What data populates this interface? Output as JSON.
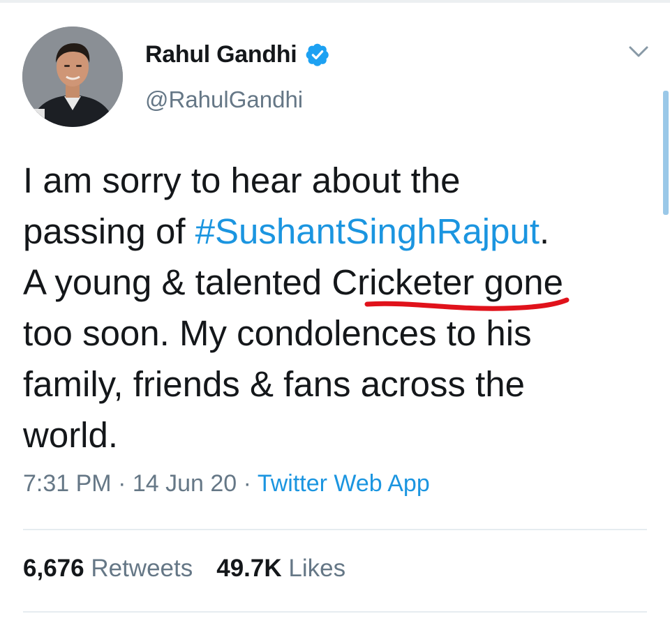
{
  "tweet": {
    "author": {
      "display_name": "Rahul Gandhi",
      "handle": "@RahulGandhi",
      "verified": true
    },
    "text_lines": [
      [
        "I am sorry to hear about the"
      ],
      [
        "passing of ",
        "#SushantSinghRajput",
        "."
      ],
      [
        "A young & talented ",
        "Cricketer gone"
      ],
      [
        "too soon. My condolences to his"
      ],
      [
        "family, friends & fans across the"
      ],
      [
        "world."
      ]
    ],
    "meta": {
      "time": "7:31 PM",
      "separator": " · ",
      "date": "14 Jun 20",
      "source": "Twitter Web App"
    },
    "stats": {
      "retweets_count": "6,676",
      "retweets_label": "Retweets",
      "likes_count": "49.7K",
      "likes_label": "Likes"
    }
  },
  "colors": {
    "link": "#1b95e0",
    "secondary_text": "#657786",
    "primary_text": "#14171a",
    "verified_badge": "#1da1f2",
    "annotation_underline": "#e0121b"
  },
  "icons": {
    "verified": "verified-badge-icon",
    "menu": "chevron-down-icon"
  }
}
